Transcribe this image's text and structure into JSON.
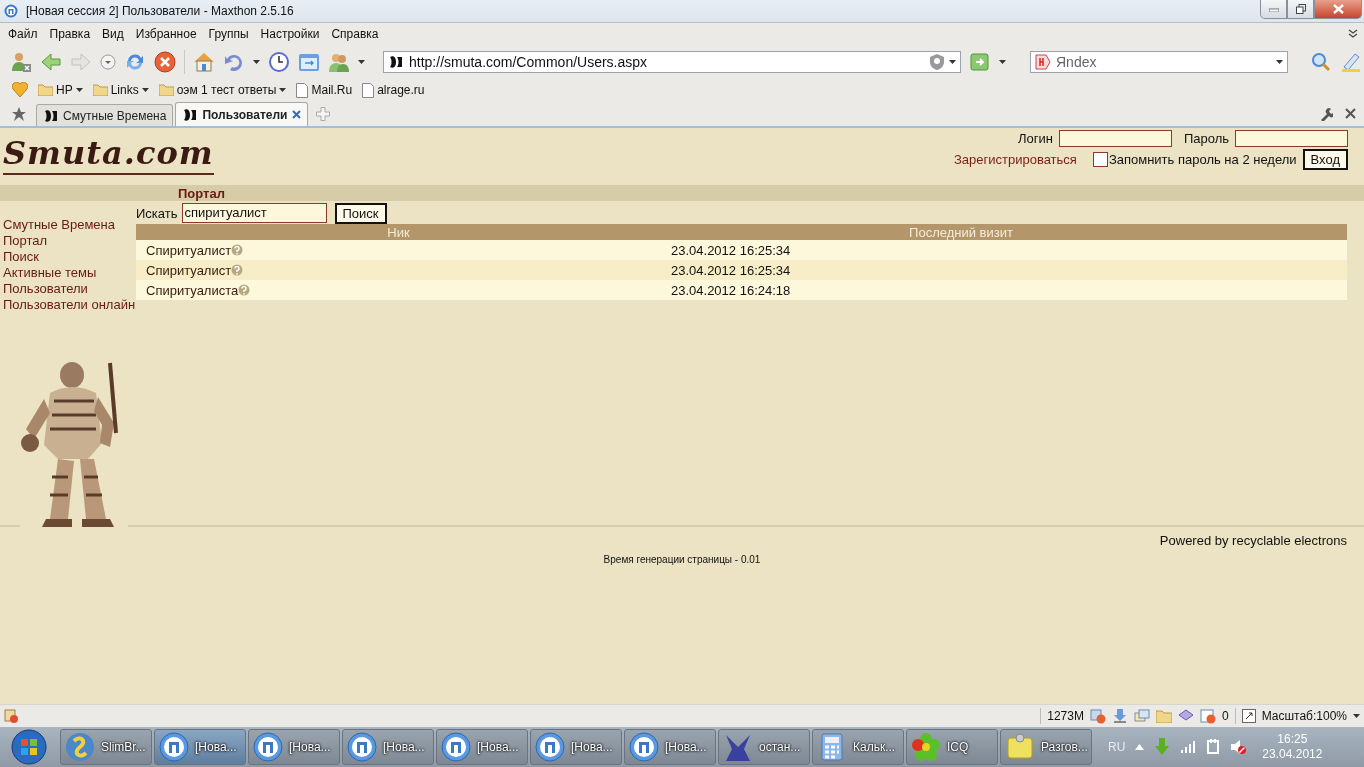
{
  "window": {
    "title": "[Новая сессия 2] Пользователи - Maxthon 2.5.16"
  },
  "menu": [
    "Файл",
    "Правка",
    "Вид",
    "Избранное",
    "Группы",
    "Настройки",
    "Справка"
  ],
  "toolbar": {
    "address": "http://smuta.com/Common/Users.aspx",
    "search_engine": "Яndex"
  },
  "bookmarks": [
    {
      "label": "HP",
      "kind": "folder"
    },
    {
      "label": "Links",
      "kind": "folder"
    },
    {
      "label": "оэм 1 тест ответы",
      "kind": "folder"
    },
    {
      "label": "Mail.Ru",
      "kind": "page"
    },
    {
      "label": "alrage.ru",
      "kind": "page"
    }
  ],
  "tabs": [
    {
      "label": "Смутные Времена",
      "selected": false
    },
    {
      "label": "Пользователи",
      "selected": true
    }
  ],
  "site": {
    "logo": "Smuta.com",
    "login_label": "Логин",
    "password_label": "Пароль",
    "register_link": "Зарегистрироваться",
    "remember": {
      "label": "Запомнить пароль на 2 недели",
      "checked": false
    },
    "login_button": "Вход",
    "section_title": "Портал",
    "nav": [
      "Смутные Времена",
      "Портал",
      "Поиск",
      "Активные темы",
      "Пользователи",
      "Пользователи онлайн"
    ],
    "search": {
      "label": "Искать",
      "value": "спиритуалист",
      "button": "Поиск"
    },
    "table": {
      "columns": [
        "Ник",
        "Последний визит"
      ],
      "rows": [
        {
          "nick": "Спиритуалист",
          "visit": "23.04.2012 16:25:34"
        },
        {
          "nick": "Спиритуалист",
          "visit": "23.04.2012 16:25:34"
        },
        {
          "nick": "Спиритуалиста",
          "visit": "23.04.2012 16:24:18"
        }
      ]
    },
    "footer": {
      "powered": "Powered by recyclable electrons",
      "generation": "Время генерации страницы - 0.01"
    }
  },
  "status_bar": {
    "memory": "1273M",
    "blocked_count": "0",
    "zoom": "Масштаб:100%"
  },
  "taskbar": {
    "items": [
      {
        "label": "SlimBr...",
        "kind": "slim",
        "selected": false
      },
      {
        "label": "[Нова...",
        "kind": "maxthon",
        "selected": true
      },
      {
        "label": "[Нова...",
        "kind": "maxthon",
        "selected": false
      },
      {
        "label": "[Нова...",
        "kind": "maxthon",
        "selected": false
      },
      {
        "label": "[Нова...",
        "kind": "maxthon",
        "selected": false
      },
      {
        "label": "[Нова...",
        "kind": "maxthon",
        "selected": false
      },
      {
        "label": "[Нова...",
        "kind": "maxthon",
        "selected": false
      },
      {
        "label": "остан...",
        "kind": "figure",
        "selected": false
      },
      {
        "label": "Кальк...",
        "kind": "calculator",
        "selected": false
      },
      {
        "label": "ICQ",
        "kind": "flower",
        "selected": false
      },
      {
        "label": "Разгов...",
        "kind": "note",
        "selected": false
      }
    ],
    "tray": {
      "language": "RU",
      "time": "16:25",
      "date": "23.04.2012"
    }
  }
}
